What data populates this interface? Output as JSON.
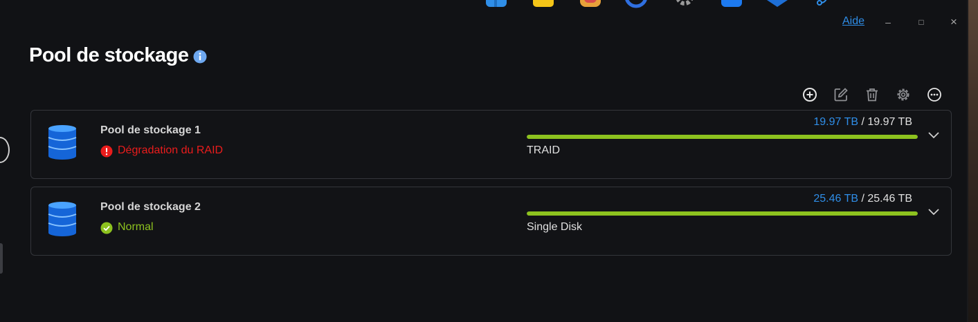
{
  "window": {
    "help_label": "Aide",
    "minimize_glyph": "–",
    "maximize_glyph": "□",
    "close_glyph": "×"
  },
  "page": {
    "title": "Pool de stockage"
  },
  "toolbar": {
    "icons": [
      "add-circle-icon",
      "edit-icon",
      "trash-icon",
      "gear-icon",
      "more-icon"
    ]
  },
  "pools": [
    {
      "name": "Pool de stockage 1",
      "status": "Dégradation du RAID",
      "status_kind": "error",
      "used": "19.97 TB",
      "separator": " / ",
      "total": "19.97 TB",
      "usage_fraction": 1.0,
      "raid_type": "TRAID"
    },
    {
      "name": "Pool de stockage 2",
      "status": "Normal",
      "status_kind": "ok",
      "used": "25.46 TB",
      "separator": " / ",
      "total": "25.46 TB",
      "usage_fraction": 1.0,
      "raid_type": "Single Disk"
    }
  ],
  "colors": {
    "accent_blue": "#2f8ee8",
    "error_red": "#ea1c1c",
    "ok_green": "#8dc21f",
    "background": "#111215"
  }
}
